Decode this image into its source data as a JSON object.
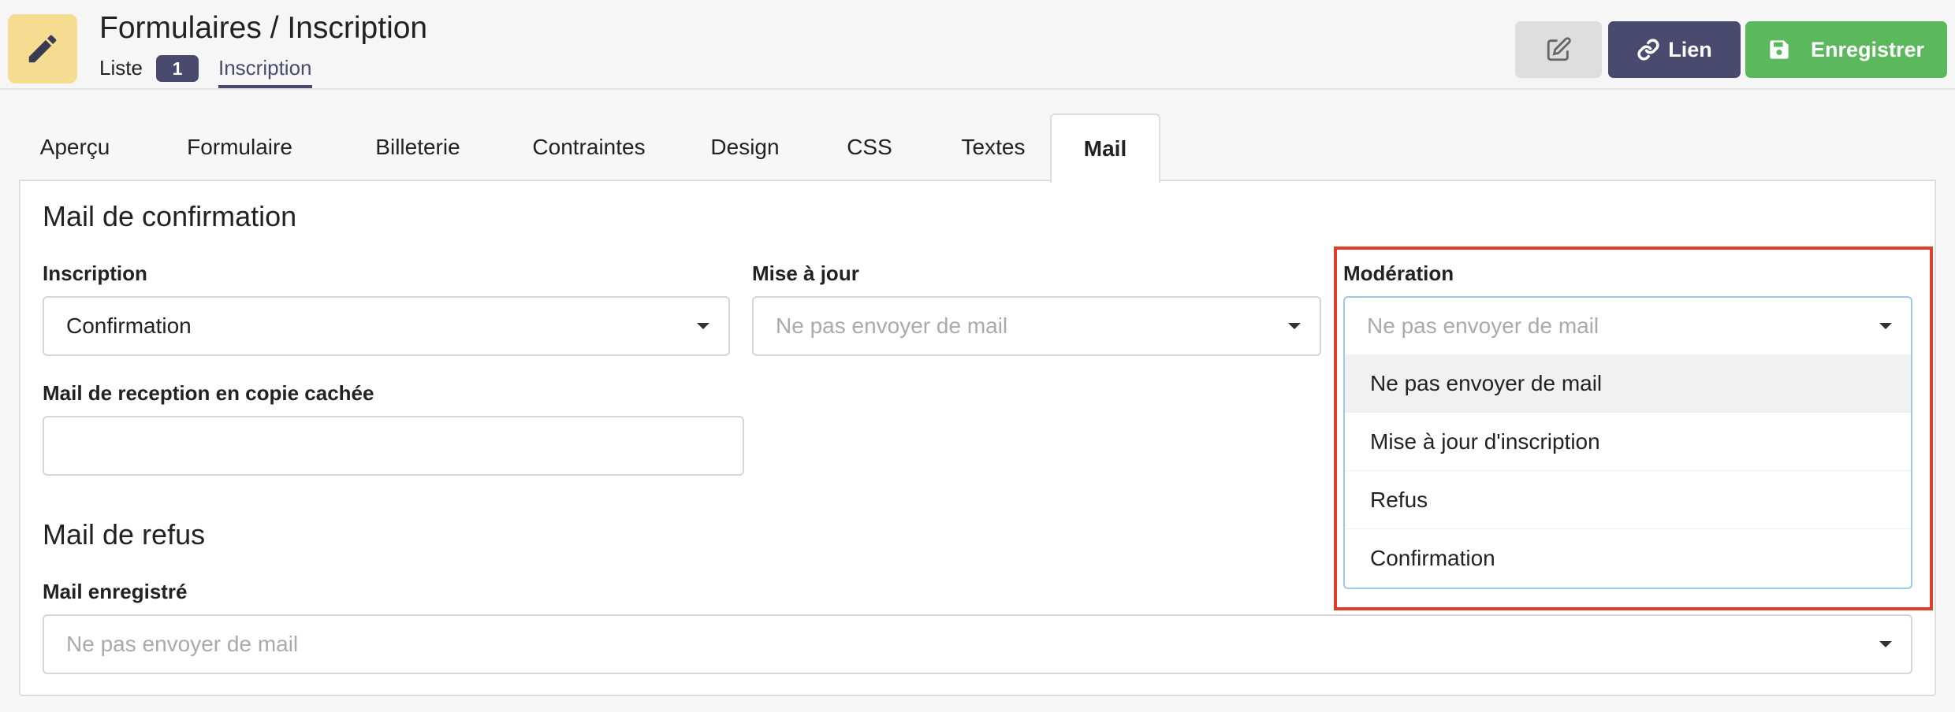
{
  "header": {
    "title": "Formulaires / Inscription",
    "app_icon": "pencil-icon",
    "subnav": {
      "list_label": "Liste",
      "list_count": "1",
      "current_label": "Inscription"
    },
    "buttons": {
      "edit_icon": "edit-icon",
      "link_label": "Lien",
      "link_icon": "link-icon",
      "save_label": "Enregistrer",
      "save_icon": "save-icon"
    }
  },
  "tabs": [
    {
      "label": "Aperçu"
    },
    {
      "label": "Formulaire"
    },
    {
      "label": "Billeterie"
    },
    {
      "label": "Contraintes"
    },
    {
      "label": "Design"
    },
    {
      "label": "CSS"
    },
    {
      "label": "Textes"
    },
    {
      "label": "Mail",
      "active": true
    }
  ],
  "confirmation": {
    "title": "Mail de confirmation",
    "inscription": {
      "label": "Inscription",
      "value": "Confirmation"
    },
    "mise_a_jour": {
      "label": "Mise à jour",
      "placeholder": "Ne pas envoyer de mail"
    },
    "moderation": {
      "label": "Modération",
      "placeholder": "Ne pas envoyer de mail",
      "options": [
        "Ne pas envoyer de mail",
        "Mise à jour d'inscription",
        "Refus",
        "Confirmation"
      ]
    },
    "bcc": {
      "label": "Mail de reception en copie cachée",
      "value": ""
    }
  },
  "refus": {
    "title": "Mail de refus",
    "saved": {
      "label": "Mail enregistré",
      "placeholder": "Ne pas envoyer de mail"
    }
  },
  "colors": {
    "accent": "#4a4a6e",
    "save": "#5cb85c",
    "app_icon_bg": "#f6dc91",
    "highlight": "#e03c2a"
  }
}
